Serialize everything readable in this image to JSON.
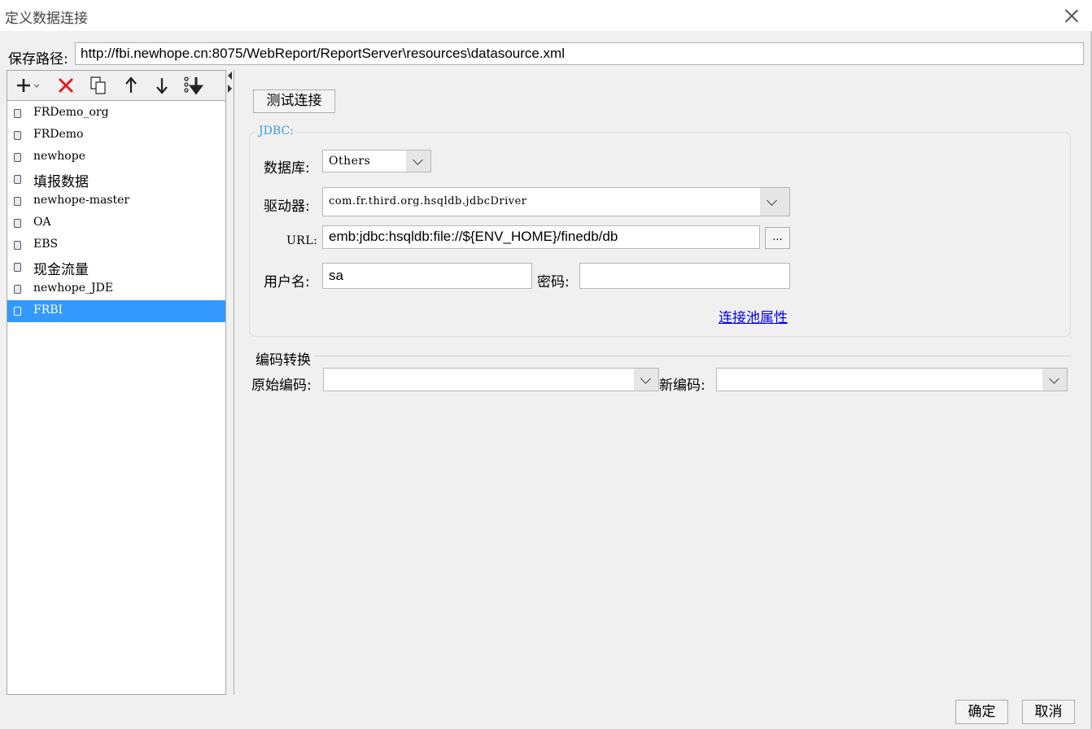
{
  "window": {
    "title": "定义数据连接"
  },
  "save_path": {
    "label": "保存路径:",
    "value": "http://fbi.newhope.cn:8075/WebReport/ReportServer\\resources\\datasource.xml"
  },
  "connections": [
    {
      "label": "FRDemo_org"
    },
    {
      "label": "FRDemo"
    },
    {
      "label": "newhope"
    },
    {
      "label": "填报数据"
    },
    {
      "label": "newhope-master"
    },
    {
      "label": "OA"
    },
    {
      "label": "EBS"
    },
    {
      "label": "现金流量"
    },
    {
      "label": "newhope_JDE"
    },
    {
      "label": "FRBI"
    }
  ],
  "selected_connection": "FRBI",
  "test_button": "测试连接",
  "jdbc": {
    "legend": "JDBC:",
    "database_label": "数据库:",
    "database_value": "Others",
    "driver_label": "驱动器:",
    "driver_value": "com.fr.third.org.hsqldb.jdbcDriver",
    "url_label": "URL:",
    "url_value": "emb:jdbc:hsqldb:file://${ENV_HOME}/finedb/db",
    "browse_label": "...",
    "username_label": "用户名:",
    "username_value": "sa",
    "password_label": "密码:",
    "password_value": "",
    "pool_link": "连接池属性"
  },
  "encoding": {
    "title": "编码转换",
    "original_label": "原始编码:",
    "original_value": "",
    "new_label": "新编码:",
    "new_value": ""
  },
  "footer": {
    "ok": "确定",
    "cancel": "取消"
  },
  "colors": {
    "selection": "#3399ff",
    "delete": "#e02020",
    "legend": "#3c9be0",
    "link": "#0000ee"
  }
}
